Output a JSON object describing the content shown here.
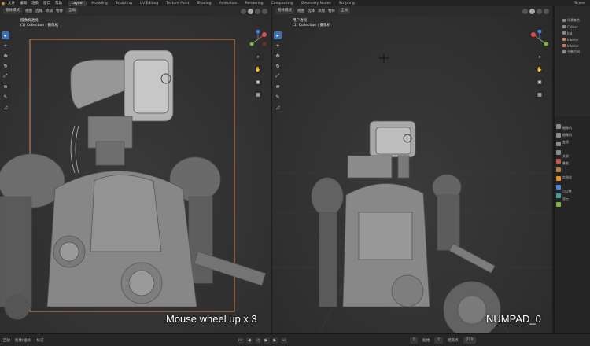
{
  "menubar": {
    "menus": [
      "文件",
      "编辑",
      "渲染",
      "窗口",
      "帮助"
    ],
    "tabs": [
      "Layout",
      "Modeling",
      "Sculpting",
      "UV Editing",
      "Texture Paint",
      "Shading",
      "Animation",
      "Rendering",
      "Compositing",
      "Geometry Nodes",
      "Scripting"
    ],
    "active_tab": "Layout",
    "scene": "Scene"
  },
  "left_view": {
    "header": {
      "mode": "物体模式",
      "view": "视图",
      "select": "选择",
      "add": "添加",
      "object": "物体",
      "transform": "全局"
    },
    "info_line1": "摄像机透视",
    "info_line2": "(1) Collection | 摄像机",
    "caption": "Mouse wheel up x 3"
  },
  "right_view": {
    "header": {
      "mode": "物体模式",
      "view": "视图",
      "select": "选择",
      "add": "添加",
      "object": "物体",
      "transform": "全局"
    },
    "info_line1": "用户透视",
    "info_line2": "(1) Collection | 摄像机",
    "caption": "NUMPAD_0"
  },
  "outliner": {
    "rows": [
      "场景集合",
      "Collect",
      "Ind",
      "Interior",
      "Interior",
      "平衡方向"
    ]
  },
  "properties": {
    "rows": [
      "摄像机",
      "摄像机",
      "变换",
      "",
      "关联",
      "集合",
      "",
      "实例化",
      "",
      "可见性",
      "显示"
    ]
  },
  "timeline": {
    "items": [
      "回放",
      "抠像(插帧)",
      "标记"
    ],
    "current_frame": "1",
    "start_label": "起始",
    "start": "1",
    "end_label": "结束点",
    "end": "250"
  },
  "colors": {
    "accent": "#3f6fb5",
    "selection": "#e88b2d",
    "background": "#333333"
  }
}
